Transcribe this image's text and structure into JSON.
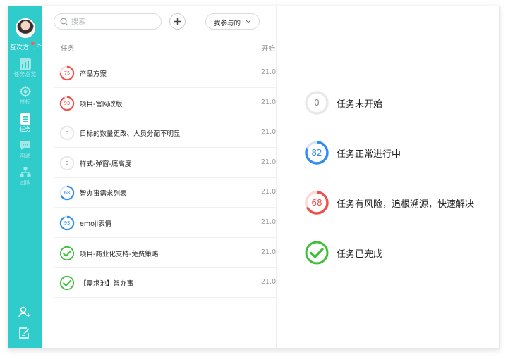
{
  "sidebar": {
    "user_name": "互次方…",
    "nav": [
      {
        "label": "任务总览",
        "icon": "bar-chart-icon",
        "active": false
      },
      {
        "label": "目标",
        "icon": "target-icon",
        "active": false
      },
      {
        "label": "任务",
        "icon": "task-list-icon",
        "active": true
      },
      {
        "label": "沟通",
        "icon": "chat-icon",
        "active": false
      },
      {
        "label": "团队",
        "icon": "team-icon",
        "active": false
      }
    ],
    "bottom_icons": [
      "add-person-icon",
      "edit-note-icon"
    ]
  },
  "toolbar": {
    "search_placeholder": "搜索",
    "filter_label": "我参与的"
  },
  "table": {
    "col_task": "任务",
    "col_start": "开始",
    "rows": [
      {
        "progress": "75",
        "value": 75,
        "status": "risk",
        "title": "产品方案",
        "date": "21.0"
      },
      {
        "progress": "93",
        "value": 93,
        "status": "risk",
        "title": "项目-官网改版",
        "date": "21.0"
      },
      {
        "progress": "0",
        "value": 0,
        "status": "not-started",
        "title": "目标的数量更改、人员分配不明显",
        "date": "21.0"
      },
      {
        "progress": "0",
        "value": 0,
        "status": "not-started",
        "title": "样式-弹窗-底高度",
        "date": "21.0"
      },
      {
        "progress": "68",
        "value": 68,
        "status": "normal",
        "title": "智办事需求列表",
        "date": "21.0"
      },
      {
        "progress": "93",
        "value": 93,
        "status": "normal",
        "title": "emoji表情",
        "date": "21.0"
      },
      {
        "progress": "",
        "value": 100,
        "status": "done",
        "title": "项目-商业化支持-免费策略",
        "date": "21.0"
      },
      {
        "progress": "",
        "value": 100,
        "status": "done",
        "title": "【需求池】智办事",
        "date": "21.0"
      }
    ]
  },
  "legend": [
    {
      "progress": "0",
      "value": 0,
      "status": "not-started",
      "label": "任务未开始"
    },
    {
      "progress": "82",
      "value": 82,
      "status": "normal",
      "label": "任务正常进行中"
    },
    {
      "progress": "68",
      "value": 68,
      "status": "risk",
      "label": "任务有风险，追根溯源，快速解决"
    },
    {
      "progress": "",
      "value": 100,
      "status": "done",
      "label": "任务已完成"
    }
  ],
  "colors": {
    "sidebar": "#2fcccb",
    "not-started": "#c9cccf",
    "normal": "#2f8cf0",
    "risk": "#f0504a",
    "done": "#3fbf3a"
  }
}
